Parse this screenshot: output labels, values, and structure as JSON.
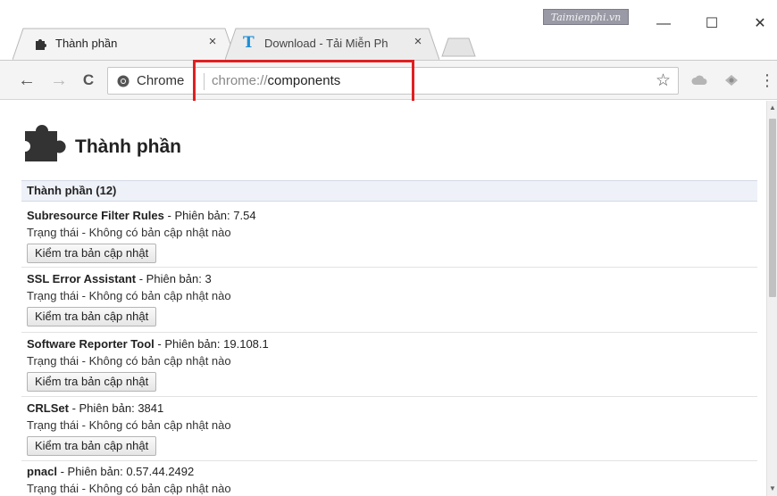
{
  "tabs": [
    {
      "title": "Thành phần",
      "icon": "puzzle-icon",
      "active": true
    },
    {
      "title": "Download - Tải Miễn Ph",
      "icon": "taimienphi-t-icon",
      "active": false
    }
  ],
  "watermark": "Taimienphi.vn",
  "window_controls": {
    "minimize": "—",
    "maximize": "☐",
    "close": "✕"
  },
  "toolbar": {
    "back": "←",
    "forward": "→",
    "reload": "C",
    "site_chip": "Chrome",
    "url_scheme": "chrome://",
    "url_path": "components",
    "bookmark_star": "☆",
    "menu": "⋮"
  },
  "page": {
    "title": "Thành phần",
    "section_header": "Thành phần (12)",
    "version_label": "Phiên bản:",
    "status_text": "Trạng thái - Không có bản cập nhật nào",
    "check_button_label": "Kiểm tra bản cập nhật",
    "components": [
      {
        "name": "Subresource Filter Rules",
        "version": "7.54"
      },
      {
        "name": "SSL Error Assistant",
        "version": "3"
      },
      {
        "name": "Software Reporter Tool",
        "version": "19.108.1"
      },
      {
        "name": "CRLSet",
        "version": "3841"
      },
      {
        "name": "pnacl",
        "version": "0.57.44.2492"
      }
    ]
  },
  "colors": {
    "highlight": "#e02020",
    "section_bg": "#eef1f8",
    "taimienphi_blue": "#1f8fd6"
  }
}
